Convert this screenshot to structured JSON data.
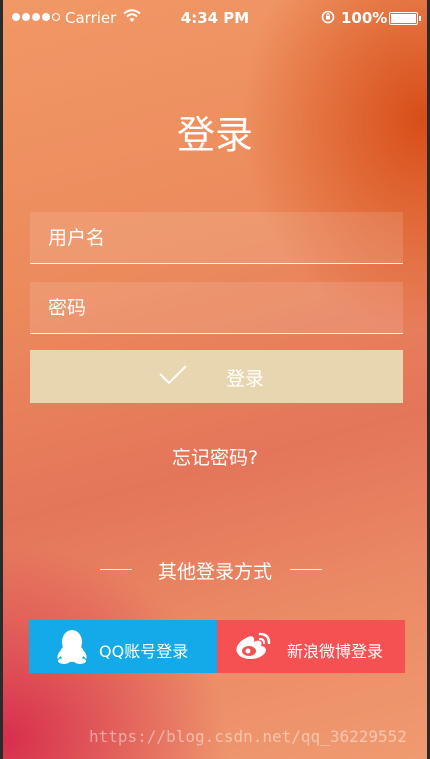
{
  "status_bar": {
    "carrier": "Carrier",
    "time": "4:34 PM",
    "battery": "100%"
  },
  "page": {
    "title": "登录"
  },
  "form": {
    "username_placeholder": "用户名",
    "password_placeholder": "密码",
    "login_label": "登录",
    "forgot_label": "忘记密码?"
  },
  "other_login": {
    "heading": "其他登录方式",
    "qq_label": "QQ账号登录",
    "weibo_label": "新浪微博登录"
  },
  "watermark": "https://blog.csdn.net/qq_36229552",
  "colors": {
    "login_button": "#e8d6b1",
    "qq": "#14a9e8",
    "weibo": "#f55052"
  }
}
